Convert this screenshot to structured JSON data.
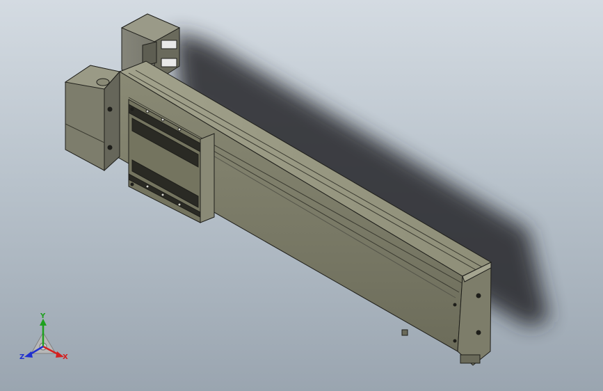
{
  "viewport": {
    "background_top": "#d4dbe2",
    "background_bottom": "#9aa5b0",
    "model_color": "#7a7a66",
    "model_edge_color": "#1e1e1a",
    "shadow_color": "#2a2d30"
  },
  "triad": {
    "x_label": "X",
    "y_label": "Y",
    "z_label": "Z",
    "x_color": "#d42020",
    "y_color": "#1fa01f",
    "z_color": "#2030d0"
  }
}
